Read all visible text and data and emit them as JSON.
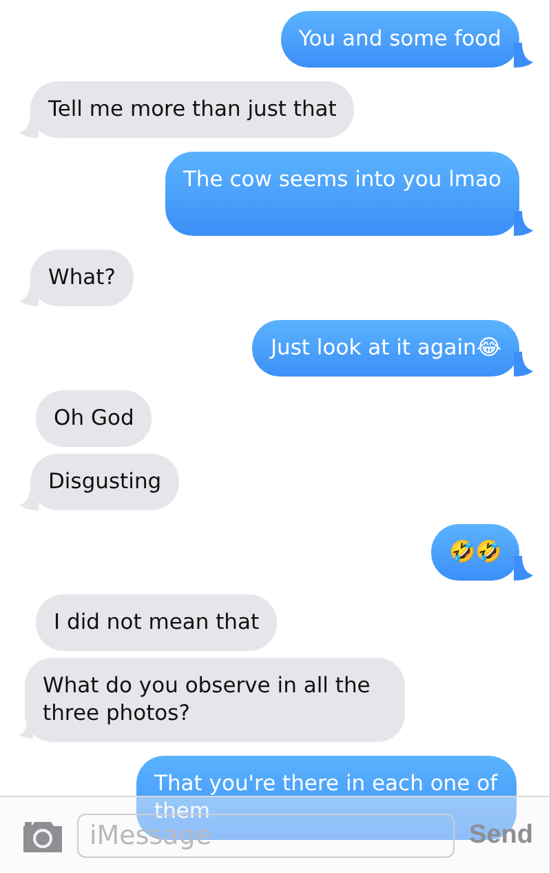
{
  "messages": [
    {
      "kind": "sent",
      "text": "You and some food",
      "tail": true
    },
    {
      "kind": "received",
      "text": "Tell me more than just that",
      "tail": true
    },
    {
      "kind": "sent",
      "text": "The cow seems into you lmao",
      "tail": true
    },
    {
      "kind": "received",
      "text": "What?",
      "tail": true
    },
    {
      "kind": "sent",
      "text": "Just look at it again😂",
      "tail": true
    },
    {
      "kind": "received",
      "text": "Oh God",
      "tail": false
    },
    {
      "kind": "received",
      "text": "Disgusting",
      "tail": true
    },
    {
      "kind": "sent",
      "text": "🤣🤣",
      "tail": true
    },
    {
      "kind": "received",
      "text": "I did not mean that",
      "tail": false
    },
    {
      "kind": "received",
      "text": "What do you observe in all the three photos?",
      "tail": true
    },
    {
      "kind": "sent",
      "text": "That you're there in each one of them",
      "tail": false
    }
  ],
  "composer": {
    "placeholder": "iMessage",
    "send": "Send"
  }
}
